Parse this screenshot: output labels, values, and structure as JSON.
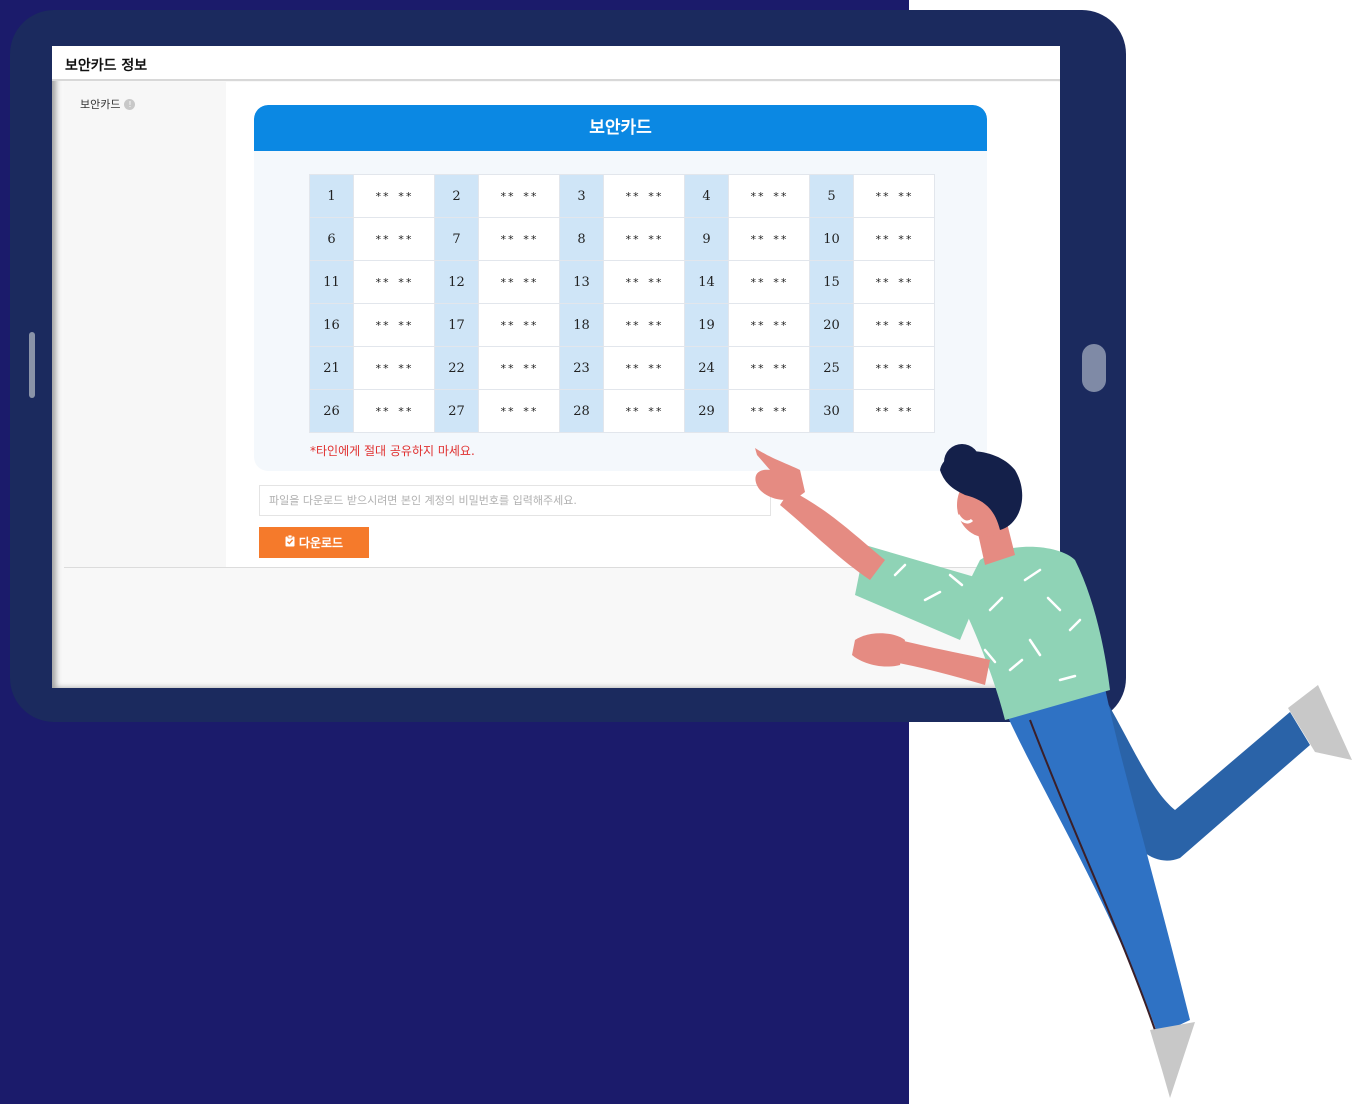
{
  "section": {
    "title": "보안카드 정보",
    "row_label": "보안카드"
  },
  "card": {
    "title": "보안카드",
    "warning": "*타인에게 절대 공유하지 마세요.",
    "cells": [
      {
        "num": "1",
        "value": "** **"
      },
      {
        "num": "2",
        "value": "** **"
      },
      {
        "num": "3",
        "value": "** **"
      },
      {
        "num": "4",
        "value": "** **"
      },
      {
        "num": "5",
        "value": "** **"
      },
      {
        "num": "6",
        "value": "** **"
      },
      {
        "num": "7",
        "value": "** **"
      },
      {
        "num": "8",
        "value": "** **"
      },
      {
        "num": "9",
        "value": "** **"
      },
      {
        "num": "10",
        "value": "** **"
      },
      {
        "num": "11",
        "value": "** **"
      },
      {
        "num": "12",
        "value": "** **"
      },
      {
        "num": "13",
        "value": "** **"
      },
      {
        "num": "14",
        "value": "** **"
      },
      {
        "num": "15",
        "value": "** **"
      },
      {
        "num": "16",
        "value": "** **"
      },
      {
        "num": "17",
        "value": "** **"
      },
      {
        "num": "18",
        "value": "** **"
      },
      {
        "num": "19",
        "value": "** **"
      },
      {
        "num": "20",
        "value": "** **"
      },
      {
        "num": "21",
        "value": "** **"
      },
      {
        "num": "22",
        "value": "** **"
      },
      {
        "num": "23",
        "value": "** **"
      },
      {
        "num": "24",
        "value": "** **"
      },
      {
        "num": "25",
        "value": "** **"
      },
      {
        "num": "26",
        "value": "** **"
      },
      {
        "num": "27",
        "value": "** **"
      },
      {
        "num": "28",
        "value": "** **"
      },
      {
        "num": "29",
        "value": "** **"
      },
      {
        "num": "30",
        "value": "** **"
      }
    ]
  },
  "password_input": {
    "placeholder": "파일을 다운로드 받으시려면 본인 계정의 비밀번호를 입력해주세요.",
    "value": ""
  },
  "download_button": {
    "label": "다운로드",
    "icon": "clipboard-check-icon"
  },
  "colors": {
    "background_navy": "#1b1b6b",
    "tablet_frame": "#1b2a5e",
    "card_header_blue": "#0b88e3",
    "number_cell_blue": "#cfe5f7",
    "warning_red": "#e0302f",
    "button_orange": "#f57a2b"
  }
}
